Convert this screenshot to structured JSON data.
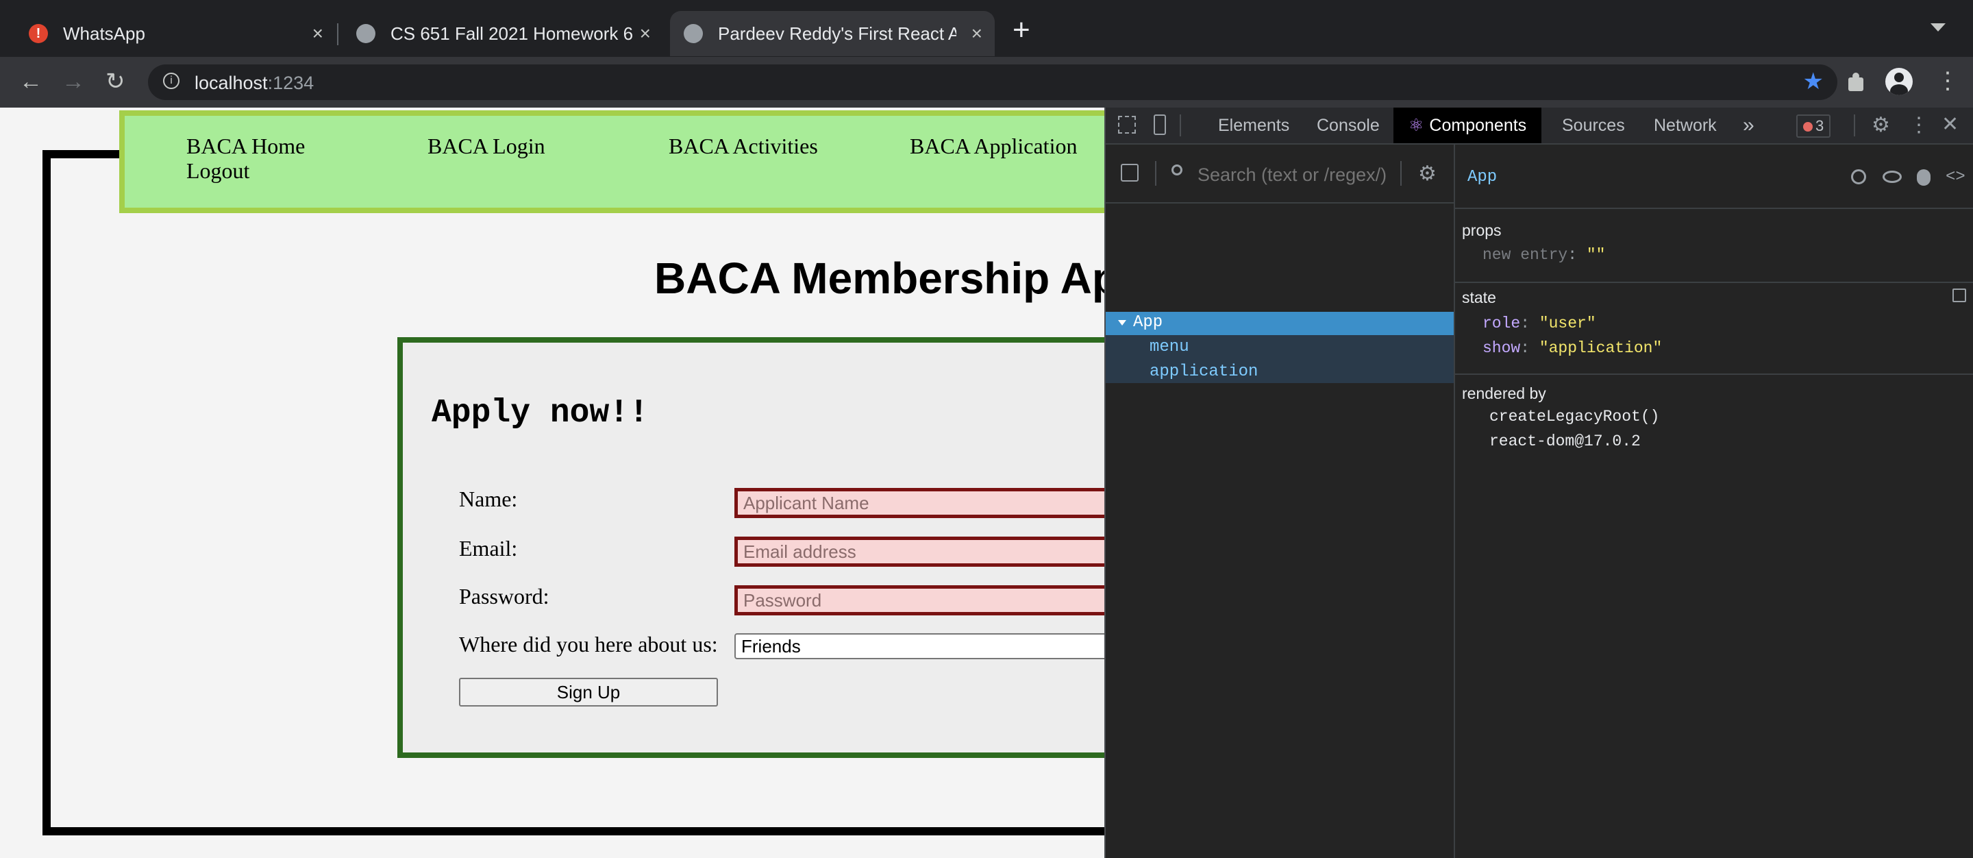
{
  "browser": {
    "tabs": [
      {
        "title": "WhatsApp",
        "close": "×"
      },
      {
        "title": "CS 651 Fall 2021 Homework 6",
        "close": "×"
      },
      {
        "title": "Pardeev Reddy's First React Ap",
        "close": "×"
      }
    ],
    "new_tab": "+",
    "url_host": "localhost",
    "url_port": ":1234"
  },
  "page": {
    "menu": {
      "home": "BACA Home",
      "logout": "Logout",
      "login": "BACA Login",
      "activities": "BACA Activities",
      "application": "BACA Application"
    },
    "heading": "BACA Membership Ap",
    "form": {
      "title": "Apply now!!",
      "name_label": "Name:",
      "name_placeholder": "Applicant Name",
      "email_label": "Email:",
      "email_placeholder": "Email address",
      "password_label": "Password:",
      "password_placeholder": "Password",
      "source_label": "Where did you here about us:",
      "source_value": "Friends",
      "submit_label": "Sign Up"
    }
  },
  "devtools": {
    "tabs": [
      "Elements",
      "Console",
      "Components",
      "Sources",
      "Network"
    ],
    "more": "»",
    "error_count": "3",
    "search_placeholder": "Search (text or /regex/)",
    "tree": {
      "root": "App",
      "children": [
        "menu",
        "application"
      ]
    },
    "selected_component": "App",
    "props_header": "props",
    "props": [
      {
        "key": "new entry",
        "value": "\"\""
      }
    ],
    "state_header": "state",
    "state": [
      {
        "key": "role",
        "value": "\"user\""
      },
      {
        "key": "show",
        "value": "\"application\""
      }
    ],
    "rendered_by_header": "rendered by",
    "rendered_by": [
      "createLegacyRoot()",
      "react-dom@17.0.2"
    ]
  },
  "colors": {
    "menu_bg": "#a8ec98",
    "menu_border": "#a4cf4a",
    "form_border": "#2d6a1f",
    "input_error_bg": "#f8d6d6",
    "input_error_border": "#7a1212",
    "devtools_selected": "#3c8fc9"
  }
}
